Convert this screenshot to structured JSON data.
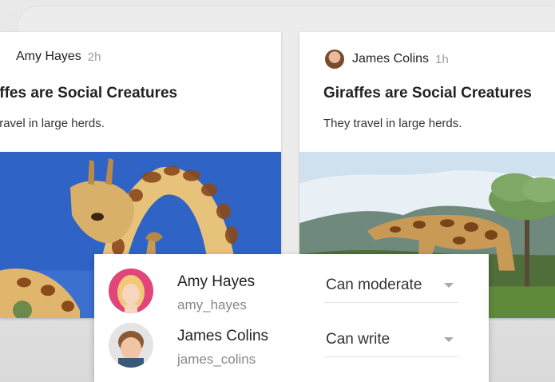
{
  "posts": [
    {
      "author": "Amy Hayes",
      "time": "2h",
      "title": "Giraffes are Social Creatures",
      "title_visible": "iffes are Social Creatures",
      "body": "They travel in large herds.",
      "body_visible": "' travel in large herds."
    },
    {
      "author": "James Colins",
      "time": "1h",
      "title": "Giraffes are Social Creatures",
      "body": "They travel in large herds."
    }
  ],
  "members": [
    {
      "name": "Amy Hayes",
      "handle": "amy_hayes",
      "role": "Can moderate"
    },
    {
      "name": "James Colins",
      "handle": "james_colins",
      "role": "Can write"
    }
  ],
  "colors": {
    "sky_blue": "#2f63c6",
    "giraffe_spot": "#8a4a1c",
    "giraffe_base": "#e7c27a",
    "caret": "#aaaaaa"
  }
}
